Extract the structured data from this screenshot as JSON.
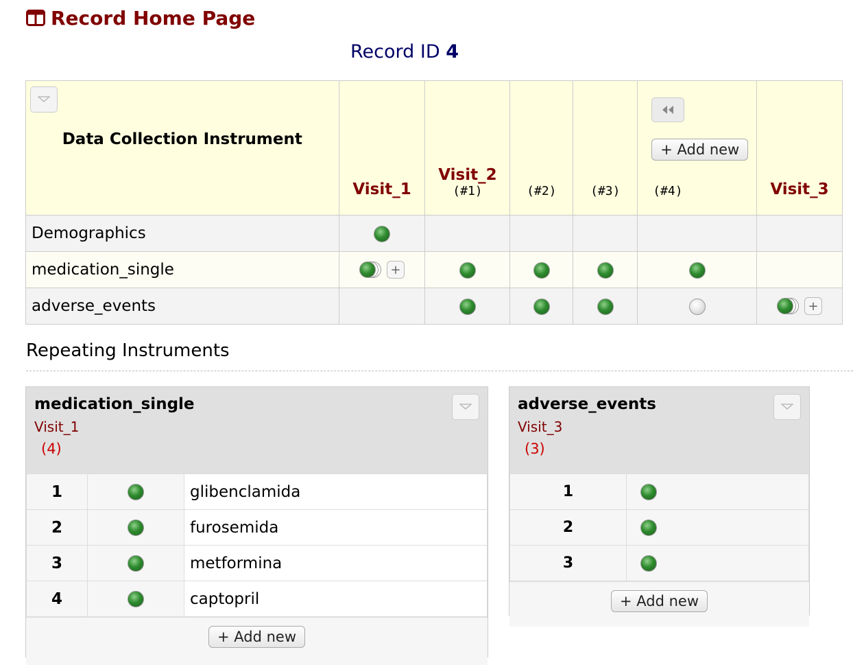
{
  "page": {
    "title": "Record Home Page",
    "record_label": "Record ID",
    "record_id": "4"
  },
  "grid": {
    "instrument_header": "Data Collection Instrument",
    "add_new_label": "+ Add new",
    "columns": [
      {
        "event": "Visit_1",
        "sub": ""
      },
      {
        "event": "Visit_2",
        "sub": "(#1)"
      },
      {
        "event": "",
        "sub": "(#2)"
      },
      {
        "event": "",
        "sub": "(#3)"
      },
      {
        "event": "",
        "sub": "(#4)"
      },
      {
        "event": "Visit_3",
        "sub": ""
      }
    ],
    "rows": [
      {
        "instrument": "Demographics",
        "cells": [
          "green",
          "",
          "",
          "",
          "",
          ""
        ]
      },
      {
        "instrument": "medication_single",
        "cells": [
          "green-stack-plus",
          "green",
          "green",
          "green",
          "green",
          ""
        ]
      },
      {
        "instrument": "adverse_events",
        "cells": [
          "",
          "green",
          "green",
          "green",
          "gray",
          "green-stack-plus"
        ]
      }
    ]
  },
  "repeating": {
    "title": "Repeating Instruments",
    "tables": [
      {
        "instrument": "medication_single",
        "event": "Visit_1",
        "count": "(4)",
        "rows": [
          {
            "num": "1",
            "status": "green",
            "value": "glibenclamida"
          },
          {
            "num": "2",
            "status": "green",
            "value": "furosemida"
          },
          {
            "num": "3",
            "status": "green",
            "value": "metformina"
          },
          {
            "num": "4",
            "status": "green",
            "value": "captopril"
          }
        ],
        "add_new_label": "+ Add new"
      },
      {
        "instrument": "adverse_events",
        "event": "Visit_3",
        "count": "(3)",
        "rows": [
          {
            "num": "1",
            "status": "green"
          },
          {
            "num": "2",
            "status": "green"
          },
          {
            "num": "3",
            "status": "green"
          }
        ],
        "add_new_label": "+ Add new"
      }
    ]
  },
  "colors": {
    "brand": "#800000",
    "header_bg": "#ffffe0",
    "status_complete": "#2e8b2e",
    "status_incomplete": "#e6e6e6",
    "count": "#cc0000"
  }
}
